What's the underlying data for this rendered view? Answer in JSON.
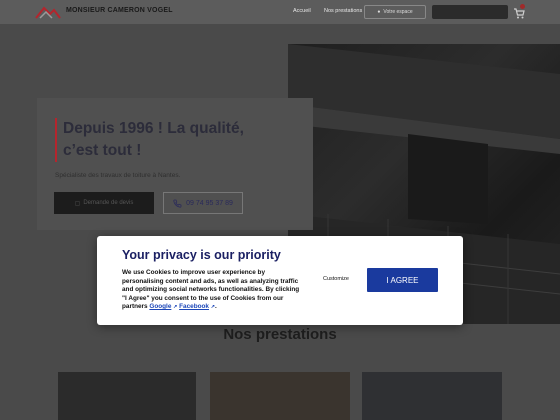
{
  "header": {
    "brand": "MONSIEUR CAMERON VOGEL",
    "nav": [
      "Accueil",
      "Nos prestations"
    ],
    "account_button": "Votre espace",
    "quote_button": "",
    "cart_icon": "cart-icon"
  },
  "hero": {
    "title": "Depuis 1996 ! La qualité, c’est tout !",
    "subtitle": "Spécialiste des travaux de toiture à Nantes.",
    "rdv_button": "Demande de devis",
    "phone_number": "09 74 95 37 89",
    "phone_icon": "phone-icon"
  },
  "section": {
    "title": "Nos prestations"
  },
  "privacy_dialog": {
    "title": "Your privacy is our priority",
    "body_text": "We use Cookies to improve user experience by personalising content and ads, as well as analyzing traffic and optimizing social networks functionalities. By clicking \"I Agree\" you consent to the use of Cookies from our partners",
    "link_google": "Google",
    "link_facebook": "Facebook",
    "customize_label": "Customize",
    "agree_label": "I AGREE"
  },
  "colors": {
    "accent_red": "#b4252d",
    "dialog_title": "#1b2063",
    "agree_button": "#1a3a9e",
    "link": "#1b46b8"
  }
}
